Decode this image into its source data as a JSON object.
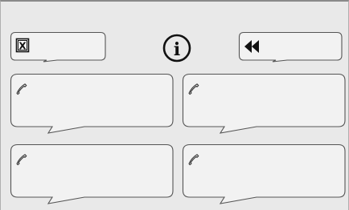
{
  "screen": {
    "background": "#e9e9e9",
    "frame_color": "#8a8a8a"
  },
  "toolbar": {
    "close": {
      "icon": "close-box-icon",
      "label": "X"
    },
    "info": {
      "icon": "info-icon",
      "label": "i"
    },
    "rewind": {
      "icon": "rewind-icon"
    }
  },
  "speed_dial": {
    "icon": "phone-handset-icon",
    "slots": [
      {
        "id": 1,
        "label": ""
      },
      {
        "id": 2,
        "label": ""
      },
      {
        "id": 3,
        "label": ""
      },
      {
        "id": 4,
        "label": ""
      }
    ]
  }
}
